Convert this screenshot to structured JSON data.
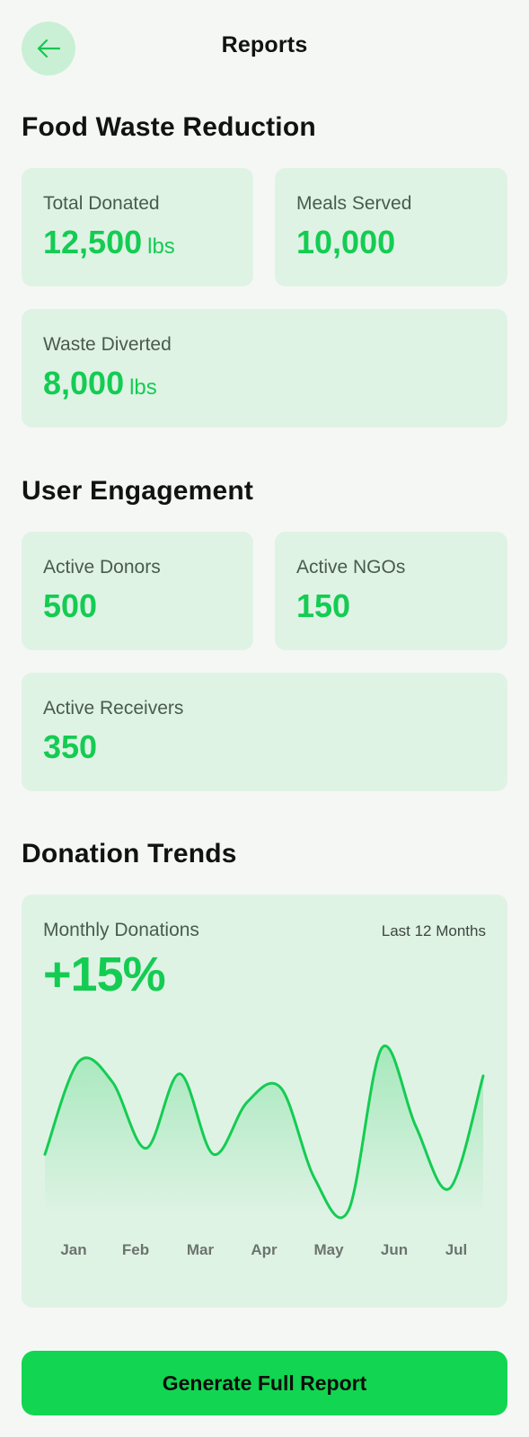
{
  "header": {
    "title": "Reports",
    "back_icon": "arrow-left-icon"
  },
  "colors": {
    "accent": "#14cc52",
    "card_bg": "#dff3e5",
    "button_bg": "#12d651",
    "back_button_bg": "#c9f0d4"
  },
  "food_waste": {
    "title": "Food Waste Reduction",
    "total_donated": {
      "label": "Total Donated",
      "value": "12,500",
      "unit": "lbs"
    },
    "meals_served": {
      "label": "Meals Served",
      "value": "10,000"
    },
    "waste_diverted": {
      "label": "Waste Diverted",
      "value": "8,000",
      "unit": "lbs"
    }
  },
  "engagement": {
    "title": "User Engagement",
    "active_donors": {
      "label": "Active Donors",
      "value": "500"
    },
    "active_ngos": {
      "label": "Active NGOs",
      "value": "150"
    },
    "active_receivers": {
      "label": "Active Receivers",
      "value": "350"
    }
  },
  "trends": {
    "title": "Donation Trends",
    "card_label": "Monthly Donations",
    "range": "Last 12 Months",
    "change": "+15%"
  },
  "chart_data": {
    "type": "area",
    "categories": [
      "Jan",
      "Feb",
      "Mar",
      "Apr",
      "May",
      "Jun",
      "Jul"
    ],
    "x": [
      0.0,
      0.5,
      1.0,
      1.5,
      2.0,
      2.5,
      3.0,
      3.5,
      4.0,
      4.5,
      5.0,
      5.5,
      6.0,
      6.5
    ],
    "values": [
      28,
      74,
      64,
      31,
      68,
      28,
      54,
      61,
      16,
      0,
      81,
      42,
      11,
      67
    ],
    "title": "",
    "xlabel": "",
    "ylabel": "",
    "ylim": [
      0,
      100
    ],
    "grid": false,
    "legend": "none"
  },
  "actions": {
    "generate_label": "Generate Full Report"
  }
}
